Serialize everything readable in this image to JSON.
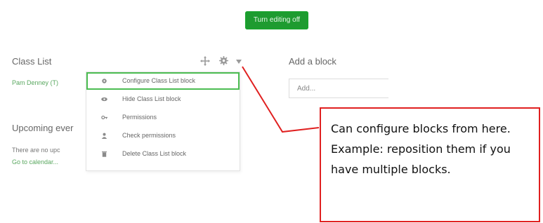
{
  "toolbar": {
    "edit_toggle_label": "Turn editing off"
  },
  "class_list": {
    "title": "Class List",
    "member": "Pam Denney (T)",
    "actions": [
      "move-icon",
      "gear-icon",
      "caret-down-icon"
    ]
  },
  "action_menu": {
    "items": [
      {
        "label": "Configure Class List block",
        "icon": "gear-icon",
        "active": true
      },
      {
        "label": "Hide Class List block",
        "icon": "eye-icon"
      },
      {
        "label": "Permissions",
        "icon": "key-icon"
      },
      {
        "label": "Check permissions",
        "icon": "user-icon"
      },
      {
        "label": "Delete Class List block",
        "icon": "trash-icon"
      }
    ]
  },
  "upcoming": {
    "title": "Upcoming ever",
    "empty_text": "There are no upc",
    "calendar_link": "Go to calendar..."
  },
  "add_block": {
    "title": "Add a block",
    "select_value": "Add..."
  },
  "annotation": {
    "text": "Can configure blocks from here. Example: reposition them if you have multiple blocks.",
    "color": "#e02020"
  },
  "colors": {
    "accent": "#1e9b30",
    "link": "#5aa860",
    "highlight": "#4cbd52"
  }
}
